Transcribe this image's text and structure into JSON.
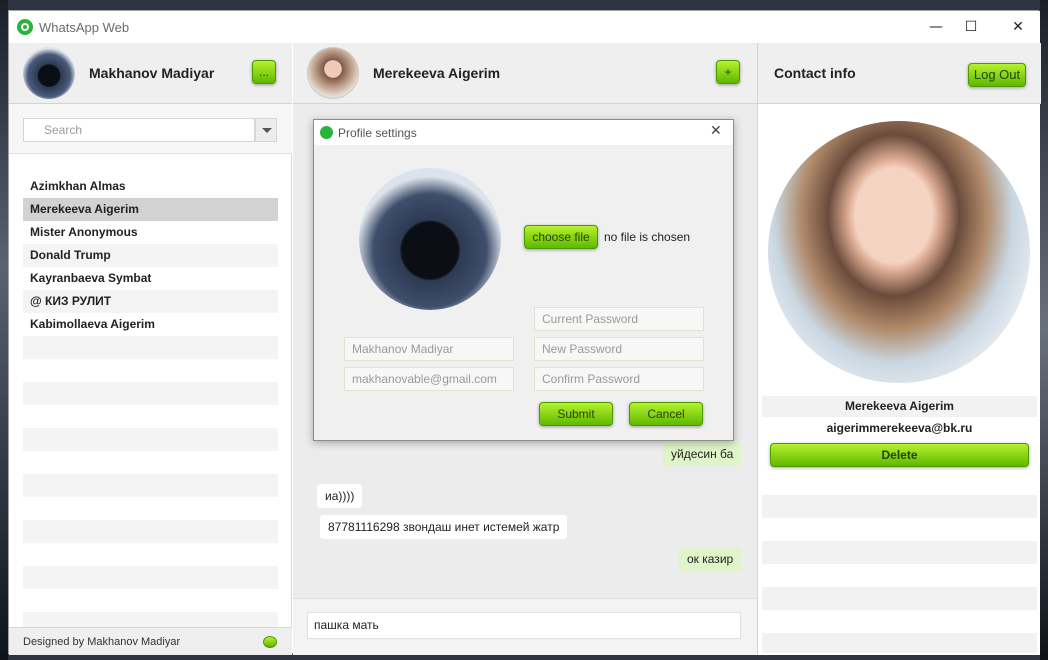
{
  "window": {
    "title": "WhatsApp Web",
    "minimize": "—",
    "maximize": "☐",
    "close": "✕"
  },
  "me": {
    "name": "Makhanov Madiyar",
    "menu_label": "..."
  },
  "search": {
    "placeholder": "Search"
  },
  "contacts": [
    "Azimkhan Almas",
    "Merekeeva Aigerim",
    "Mister Anonymous",
    "Donald Trump",
    "Kayranbaeva Symbat",
    "@ КИЗ РУЛИТ",
    "Kabimollaeva Aigerim"
  ],
  "selected_contact": "Merekeeva Aigerim",
  "footer": {
    "credit": "Designed by Makhanov Madiyar"
  },
  "chat": {
    "contact_name": "Merekeeva Aigerim",
    "add_label": "+",
    "messages": [
      {
        "dir": "out",
        "text": "уйдесин ба"
      },
      {
        "dir": "in",
        "text": "иа))))"
      },
      {
        "dir": "in",
        "text": "87781116298 звондаш инет истемей жатр"
      },
      {
        "dir": "out",
        "text": "ок казир"
      }
    ],
    "draft": "пашка мать"
  },
  "contact_info": {
    "title": "Contact info",
    "logout_label": "Log Out",
    "name": "Merekeeva Aigerim",
    "email": "aigerimmerekeeva@bk.ru",
    "delete_label": "Delete"
  },
  "profile_dialog": {
    "title": "Profile settings",
    "choose_file_label": "choose file",
    "file_status": "no file is chosen",
    "name_placeholder": "Makhanov Madiyar",
    "email_placeholder": "makhanovable@gmail.com",
    "current_password_placeholder": "Current Password",
    "new_password_placeholder": "New Password",
    "confirm_password_placeholder": "Confirm Password",
    "submit_label": "Submit",
    "cancel_label": "Cancel",
    "close": "✕"
  },
  "colors": {
    "accent_green": "#7fd400",
    "out_bubble": "#dff4c8",
    "panel_bg": "#efefef"
  }
}
